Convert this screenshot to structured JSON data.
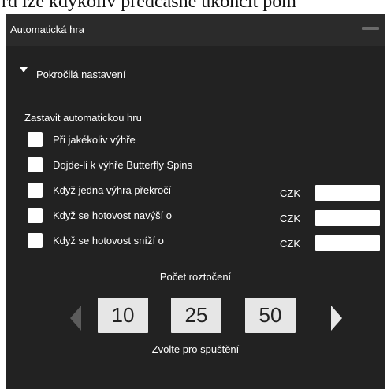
{
  "top_strip_text": "rd lze kdykoliv předčasně ukončit pom",
  "header": {
    "title": "Automatická hra"
  },
  "advanced": {
    "label": "Pokročilá nastavení"
  },
  "stop_autoplay": {
    "title": "Zastavit automatickou hru",
    "options": [
      {
        "label": "Při jakékoliv výhře"
      },
      {
        "label": "Dojde-li k výhře Butterfly Spins"
      },
      {
        "label": "Když jedna výhra překročí",
        "currency": "CZK",
        "value": ""
      },
      {
        "label": "Když se hotovost navýší o",
        "currency": "CZK",
        "value": ""
      },
      {
        "label": "Když se hotovost sníží o",
        "currency": "CZK",
        "value": ""
      }
    ]
  },
  "spins": {
    "title": "Počet roztočení",
    "options": [
      "10",
      "25",
      "50"
    ],
    "hint": "Zvolte pro spuštění"
  },
  "colors": {
    "panel_background": "#222222",
    "header_background": "#2b2b2b",
    "spin_button_background": "#e6e6e6",
    "left_arrow_disabled": "#5c5c5c",
    "right_arrow_enabled": "#e8e8e8"
  }
}
